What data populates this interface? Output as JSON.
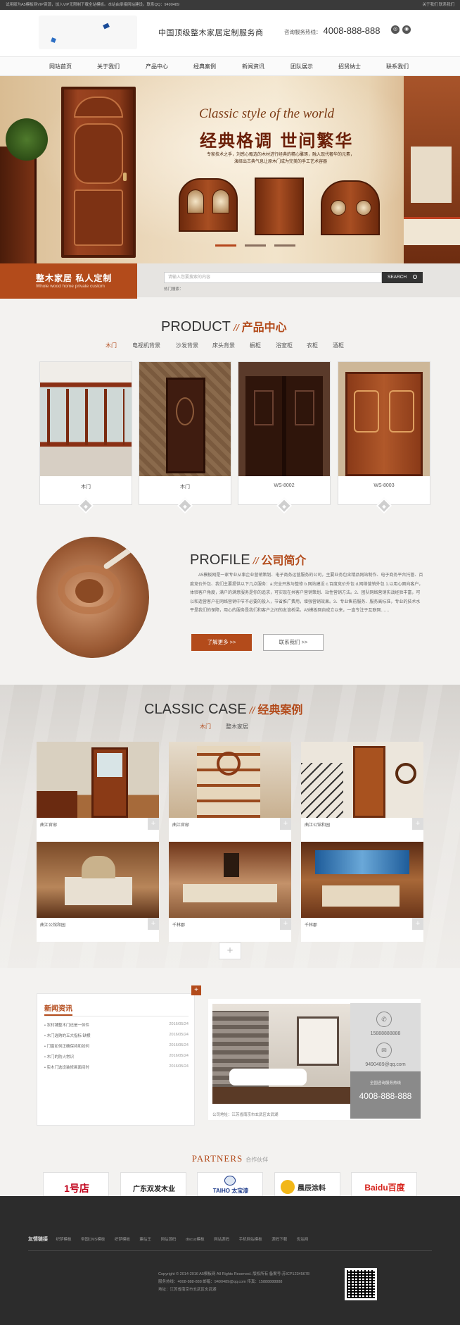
{
  "topbar": {
    "left": "试用版为A5模板网VIP资源，加入VIP无限制下载全站模板。本站由承接网站建设。联系QQ：9490489",
    "right": "关于我们   联系我们"
  },
  "header": {
    "slogan": "中国顶级整木家居定制服务商",
    "hotline_label": "咨询服务热线：",
    "hotline": "4008-888-888"
  },
  "nav": [
    "网站首页",
    "关于我们",
    "产品中心",
    "经典案例",
    "新闻资讯",
    "团队展示",
    "招贤纳士",
    "联系我们"
  ],
  "banner": {
    "en": "Classic style of the world",
    "cn": "经典格调 世间繁华",
    "desc": "专家技术之手，刘感心甄选的木材进行经典的精心雕琢，融入现代奢华的元素，演绎出古典气息让原木门成为完美的手工艺术容器"
  },
  "tag": {
    "title": "整木家居  私人定制",
    "sub": "Whole wood  home private custom"
  },
  "search": {
    "placeholder": "请输入您要搜索的内容",
    "button": "SEARCH",
    "hot": "热门搜索："
  },
  "product": {
    "en": "PRODUCT",
    "cn": "产品中心",
    "tabs": [
      "木门",
      "电视机背景",
      "沙发背景",
      "床头背景",
      "橱柜",
      "浴室柜",
      "衣柜",
      "酒柜"
    ],
    "items": [
      "木门",
      "木门",
      "WS-8002",
      "WS-8003"
    ]
  },
  "profile": {
    "en": "PROFILE",
    "cn": "公司简介",
    "text": "A5模板网是一家专业从事企业营销策划、电子商务运营服务的公司，主要业务包含精品网站制作、电子商务平台托管、百度竞价外包、我们主要提供以下几点服务：a.完全开放与整修 b.网站建设 c.百度竞价外包 d.网络营销外包 1.以用心面向客户，体验客户角度，满户的满意服务是你的追求，可实现在共客户营销策划、站性营销方法。2、团队网络营销实战经验丰富，可以和造营客户在网络营销中节不必要的投入，节省推广费用，增强营销效果。3、专业售前服务、服务高标准，专业的技术水平是我们的保障，用心的服务是我们和客户之间的友谊桥梁。A5模板网自成立以来，一直专注于互联网……",
    "btn_more": "了解更多 >>",
    "btn_contact": "联系我们 >>"
  },
  "cases": {
    "en": "CLASSIC CASE",
    "cn": "经典案例",
    "tabs": [
      "木门",
      "整木家居"
    ],
    "items": [
      "曲江官邸",
      "曲江官邸",
      "曲江公馆和园",
      "曲江公馆和园",
      "千林郡",
      "千林郡"
    ],
    "more": "+"
  },
  "news": {
    "title": "新闻资讯",
    "plus": "+",
    "items": [
      {
        "t": "农村铺整木门还是一体件",
        "d": "2016/05/24"
      },
      {
        "t": "木门选购的五大指标 缺横",
        "d": "2016/05/24"
      },
      {
        "t": "门窗如何正确保持和如何",
        "d": "2016/05/24"
      },
      {
        "t": "木门的防火常识",
        "d": "2016/05/24"
      },
      {
        "t": "实木门选设装修画面间时",
        "d": "2016/05/24"
      }
    ]
  },
  "contact": {
    "addr": "公司地址：江苏省南京市玄武区玄武湖",
    "phone": "15888888888",
    "qq": "9490489@qq.com",
    "tel_label": "全国咨询服务热线",
    "tel": "4008-888-888"
  },
  "partners": {
    "title": "PARTNERS",
    "sub": "合作伙伴",
    "logos": [
      "1号店",
      "广东双发木业",
      "TAIHO 太宝漆",
      "晨辰涂料",
      "Baidu百度"
    ]
  },
  "footer": {
    "links_label": "友情链接",
    "links": [
      "织梦模板",
      "帝国CMS模板",
      "织梦模板",
      "建站王",
      "网站源码",
      "discuz模板",
      "网站源码",
      "手机网站模板",
      "源码下载",
      "优站网"
    ],
    "copy1": "Copyright © 2014-2016 A5模板网 All Rights Reserved. 版权所有  备案号:苏ICP12345678",
    "copy2": "服务热线：4008-888-888    邮箱：9490489@qq.com    传真：15888888888",
    "copy3": "地址：江苏省南京市玄武区玄武湖"
  },
  "colors": {
    "accent": "#b34b1b",
    "footer": "#2c2c2c"
  }
}
